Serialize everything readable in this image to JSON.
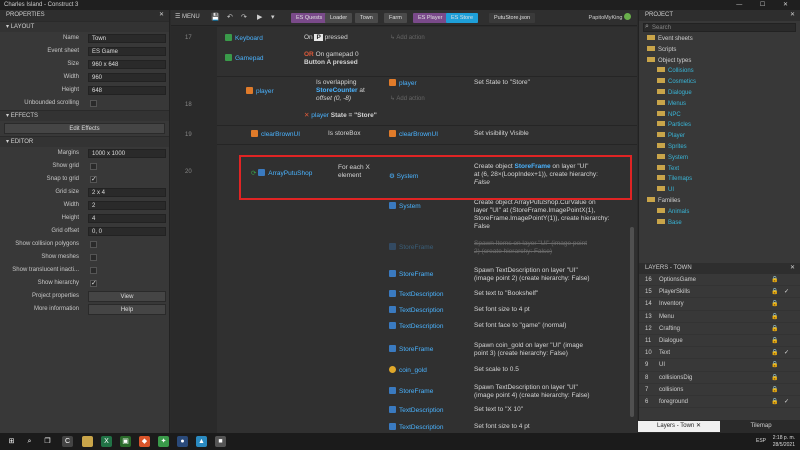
{
  "window": {
    "title": "Charles Island - Construct 3",
    "controls": "— ☐ ✕"
  },
  "properties": {
    "header": "PROPERTIES",
    "sections": {
      "layout": "LAYOUT",
      "effects": "EFFECTS",
      "editor": "EDITOR"
    },
    "layout": [
      {
        "label": "Name",
        "value": "Town"
      },
      {
        "label": "Event sheet",
        "value": "ES Game"
      },
      {
        "label": "Size",
        "value": "960 x 648"
      },
      {
        "label": "Width",
        "value": "960"
      },
      {
        "label": "Height",
        "value": "648"
      },
      {
        "label": "Unbounded scrolling",
        "value": ""
      }
    ],
    "edit_effects": "Edit Effects",
    "editor": [
      {
        "label": "Margins",
        "value": "1000 x 1000"
      },
      {
        "label": "Show grid",
        "value": ""
      },
      {
        "label": "Snap to grid",
        "value": ""
      },
      {
        "label": "Grid size",
        "value": "2 x 4"
      },
      {
        "label": "Width",
        "value": "2"
      },
      {
        "label": "Height",
        "value": "4"
      },
      {
        "label": "Grid offset",
        "value": "0, 0"
      },
      {
        "label": "Show collision polygons",
        "value": ""
      },
      {
        "label": "Show meshes",
        "value": ""
      },
      {
        "label": "Show translucent inacti...",
        "value": ""
      },
      {
        "label": "Show hierarchy",
        "value": ""
      },
      {
        "label": "Project properties",
        "value": "View"
      },
      {
        "label": "More information",
        "value": "Help"
      }
    ]
  },
  "toolbar": {
    "menu": "MENU",
    "tabs": [
      "ES Quests",
      "Loader",
      "Town",
      "Farm",
      "ES Player",
      "ES Store",
      "PutuStore.json"
    ],
    "active_tab": "ES Store",
    "user": "PapitoMyKing"
  },
  "events": {
    "rows": [
      "17",
      "18",
      "19",
      "20"
    ],
    "e17": {
      "obj1": "Keyboard",
      "cond1a": "On",
      "cond1key": "P",
      "cond1b": "pressed",
      "obj2": "Gamepad",
      "or": "OR",
      "cond2a": "On gamepad 0",
      "cond2b": "Button A pressed",
      "add_action": "Add action"
    },
    "e18": {
      "obj": "player",
      "cond1a": "Is overlapping",
      "cond1obj": "StoreCounter",
      "cond1b": "at",
      "cond1c": "offset (0, -8)",
      "cond2obj": "player",
      "cond2": "State = \"Store\"",
      "act_obj": "player",
      "act": "Set State to \"Store\"",
      "add_action": "Add action"
    },
    "e19": {
      "obj": "clearBrownUI",
      "cond": "Is storeBox",
      "act_obj": "clearBrownUI",
      "act": "Set visibility Visible"
    },
    "e20": {
      "obj": "ArrayPutuShop",
      "cond1": "For each X",
      "cond2": "element",
      "act_obj": "System",
      "act_l1a": "Create object",
      "act_l1obj": "StoreFrame",
      "act_l1b": "on layer \"UI\"",
      "act_l2": "at (6, 28×(LoopIndex+1)), create hierarchy:",
      "act_l3": "False"
    },
    "actions": [
      {
        "obj": "System",
        "lines": [
          "Create object ArrayPutuShop.CurValue on",
          "layer \"UI\" at (StoreFrame.ImagePointX(1),",
          "StoreFrame.ImagePointY(1)), create hierarchy:",
          "False"
        ]
      },
      {
        "obj": "StoreFrame",
        "lines": [
          "Spawn Items on layer \"UI\" (image point",
          "2) (create hierarchy: False)"
        ],
        "disabled": true
      },
      {
        "obj": "StoreFrame",
        "lines": [
          "Spawn TextDescription on layer \"UI\"",
          "(image point 2) (create hierarchy: False)"
        ]
      },
      {
        "obj": "TextDescription",
        "lines": [
          "Set text to \"Bookshelf\""
        ]
      },
      {
        "obj": "TextDescription",
        "lines": [
          "Set font size to 4 pt"
        ]
      },
      {
        "obj": "TextDescription",
        "lines": [
          "Set font face to \"game\" (normal)"
        ]
      },
      {
        "obj": "StoreFrame",
        "lines": [
          "Spawn coin_gold on layer \"UI\" (image",
          "point 3) (create hierarchy: False)"
        ]
      },
      {
        "obj": "coin_gold",
        "lines": [
          "Set scale to 0.5"
        ]
      },
      {
        "obj": "StoreFrame",
        "lines": [
          "Spawn TextDescription on layer \"UI\"",
          "(image point 4) (create hierarchy: False)"
        ]
      },
      {
        "obj": "TextDescription",
        "lines": [
          "Set text to \"X 10\""
        ]
      },
      {
        "obj": "TextDescription",
        "lines": [
          "Set font size to 4 pt"
        ]
      }
    ]
  },
  "project": {
    "header": "PROJECT",
    "search_placeholder": "Search",
    "items": [
      {
        "label": "Event sheets",
        "level": 1
      },
      {
        "label": "Scripts",
        "level": 1
      },
      {
        "label": "Object types",
        "level": 1
      },
      {
        "label": "Collisions",
        "level": 2
      },
      {
        "label": "Cosmetics",
        "level": 2
      },
      {
        "label": "Dialogue",
        "level": 2
      },
      {
        "label": "Menus",
        "level": 2
      },
      {
        "label": "NPC",
        "level": 2
      },
      {
        "label": "Particles",
        "level": 2
      },
      {
        "label": "Player",
        "level": 2
      },
      {
        "label": "Sprites",
        "level": 2
      },
      {
        "label": "System",
        "level": 2
      },
      {
        "label": "Text",
        "level": 2
      },
      {
        "label": "Tilemaps",
        "level": 2
      },
      {
        "label": "UI",
        "level": 2
      },
      {
        "label": "Families",
        "level": 1
      },
      {
        "label": "Animals",
        "level": 2
      },
      {
        "label": "Base",
        "level": 2
      }
    ]
  },
  "layers": {
    "header": "LAYERS - TOWN",
    "items": [
      {
        "num": "16",
        "name": "OptionsGame",
        "visible": false
      },
      {
        "num": "15",
        "name": "PlayerSkills",
        "visible": true
      },
      {
        "num": "14",
        "name": "Inventory",
        "visible": false
      },
      {
        "num": "13",
        "name": "Menu",
        "visible": false
      },
      {
        "num": "12",
        "name": "Crafting",
        "visible": false
      },
      {
        "num": "11",
        "name": "Dialogue",
        "visible": false
      },
      {
        "num": "10",
        "name": "Text",
        "visible": true
      },
      {
        "num": "9",
        "name": "UI",
        "visible": false
      },
      {
        "num": "8",
        "name": "collisionsDig",
        "visible": false
      },
      {
        "num": "7",
        "name": "collisions",
        "visible": false
      },
      {
        "num": "6",
        "name": "foreground",
        "visible": true
      }
    ],
    "tab_layers": "Layers - Town",
    "tab_tilemap": "Tilemap"
  },
  "taskbar": {
    "lang": "ESP",
    "time": "2:18 p. m.",
    "date": "28/5/2021"
  },
  "colors": {
    "accent": "#1e9fd8",
    "highlight": "#e02424",
    "object": "#4ab3ff"
  }
}
